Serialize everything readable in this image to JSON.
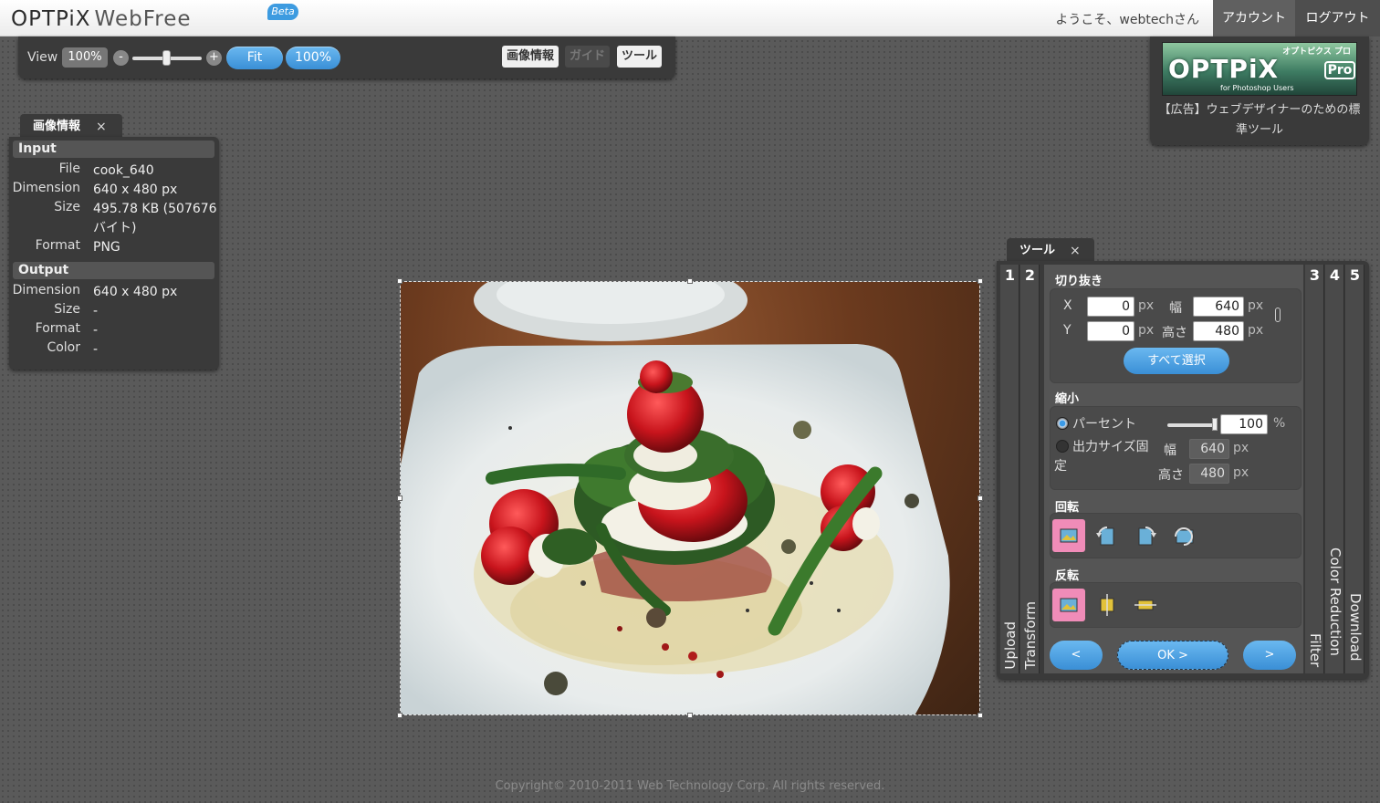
{
  "header": {
    "logo": "OPTPiX",
    "logo_product": "WebFree",
    "logo_badge": "Beta",
    "welcome": "ようこそ、webtechさん",
    "account": "アカウント",
    "logout": "ログアウト"
  },
  "viewbar": {
    "label": "View",
    "zoom": "100%",
    "zoom_out": "-",
    "zoom_in": "+",
    "fit": "Fit",
    "actual": "100%",
    "zoom_slider": 0.5,
    "toggles": [
      {
        "label": "画像情報",
        "active": true
      },
      {
        "label": "ガイド",
        "active": false
      },
      {
        "label": "ツール",
        "active": true
      }
    ]
  },
  "ad": {
    "banner_small": "オプトピクス プロ",
    "banner_big": "OPTPiX",
    "banner_pro": "Pro",
    "banner_sub": "for Photoshop Users",
    "text": "【広告】ウェブデザイナーのための標準ツール"
  },
  "info_panel": {
    "tab": "画像情報",
    "close": "×",
    "input_title": "Input",
    "input": [
      {
        "key": "File",
        "value": "cook_640"
      },
      {
        "key": "Dimension",
        "value": "640 x 480 px"
      },
      {
        "key": "Size",
        "value": "495.78 KB (507676 バイト)"
      },
      {
        "key": "Format",
        "value": "PNG"
      }
    ],
    "output_title": "Output",
    "output": [
      {
        "key": "Dimension",
        "value": "640 x 480 px"
      },
      {
        "key": "Size",
        "value": "-"
      },
      {
        "key": "Format",
        "value": "-"
      },
      {
        "key": "Color",
        "value": "-"
      }
    ]
  },
  "tool_panel": {
    "tab": "ツール",
    "close": "×",
    "steps": [
      {
        "num": "1",
        "label": "Upload"
      },
      {
        "num": "2",
        "label": "Transform"
      },
      {
        "num": "3",
        "label": "Filter"
      },
      {
        "num": "4",
        "label": "Color Reduction"
      },
      {
        "num": "5",
        "label": "Download"
      }
    ],
    "crop": {
      "title": "切り抜き",
      "x_label": "X",
      "x": "0",
      "y_label": "Y",
      "y": "0",
      "w_label": "幅",
      "w": "640",
      "h_label": "高さ",
      "h": "480",
      "unit": "px",
      "select_all": "すべて選択"
    },
    "resize": {
      "title": "縮小",
      "percent_label": "パーセント",
      "percent": "100",
      "percent_unit": "%",
      "fixed_label": "出力サイズ固",
      "fixed_label2": "定",
      "w_label": "幅",
      "w": "640",
      "h_label": "高さ",
      "h": "480",
      "unit": "px",
      "slider": 1.0
    },
    "rotate": {
      "title": "回転"
    },
    "flip": {
      "title": "反転"
    },
    "prev": "<",
    "ok": "OK >",
    "next": ">"
  },
  "footer": "Copyright© 2010-2011 Web Technology Corp. All rights reserved.",
  "colors": {
    "accent": "#3a8fd6",
    "selected_tool": "#f08cb8",
    "panel": "#3a3a3a"
  }
}
